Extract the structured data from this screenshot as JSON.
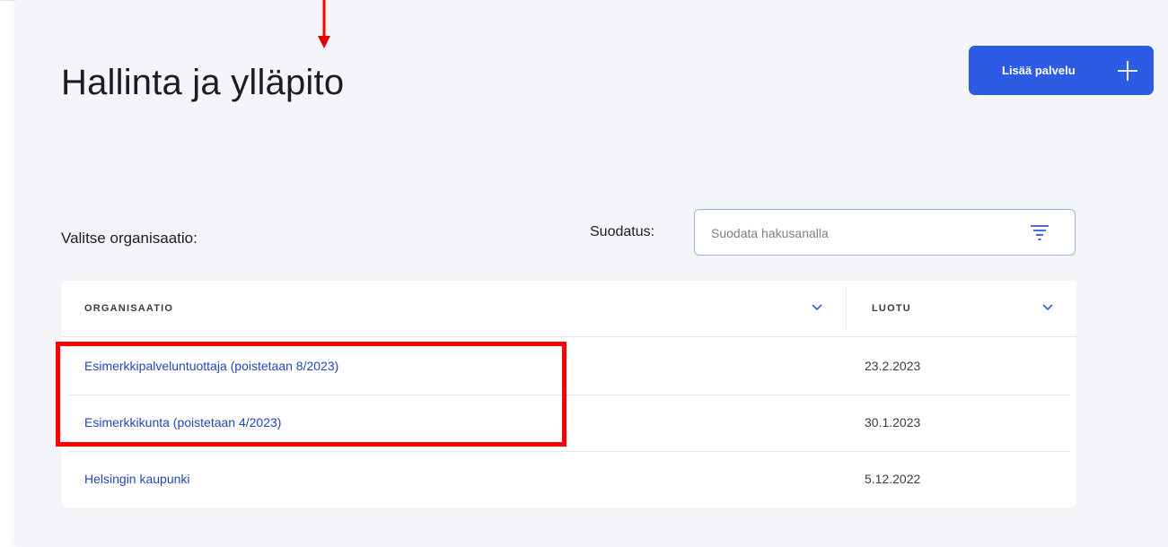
{
  "page": {
    "title": "Hallinta ja ylläpito",
    "add_button_label": "Lisää palvelu",
    "accent_color": "#2d5be3"
  },
  "organization": {
    "label": "Valitse organisaatio:"
  },
  "filter": {
    "label": "Suodatus:",
    "placeholder": "Suodata hakusanalla",
    "value": ""
  },
  "table": {
    "columns": [
      "ORGANISAATIO",
      "LUOTU"
    ],
    "rows": [
      {
        "name": "Esimerkkipalveluntuottaja (poistetaan 8/2023)",
        "created": "23.2.2023"
      },
      {
        "name": "Esimerkkikunta (poistetaan 4/2023)",
        "created": "30.1.2023"
      },
      {
        "name": "Helsingin kaupunki",
        "created": "5.12.2022"
      }
    ]
  },
  "annotations": {
    "highlight_color": "#ff0000"
  }
}
